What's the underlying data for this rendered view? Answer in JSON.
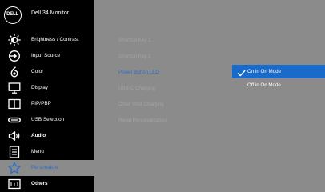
{
  "header": {
    "logo_text": "DELL",
    "model": "Dell 34 Monitor"
  },
  "menu": {
    "items": [
      {
        "label": "Brightness / Contrast",
        "icon": "brightness-icon"
      },
      {
        "label": "Input Source",
        "icon": "input-source-icon"
      },
      {
        "label": "Color",
        "icon": "color-icon"
      },
      {
        "label": "Display",
        "icon": "display-icon"
      },
      {
        "label": "PIP/PBP",
        "icon": "pip-pbp-icon"
      },
      {
        "label": "USB Selection",
        "icon": "usb-icon"
      },
      {
        "label": "Audio",
        "icon": "speaker-icon"
      },
      {
        "label": "Menu",
        "icon": "menu-document-icon"
      },
      {
        "label": "Personalize",
        "icon": "star-icon",
        "selected": true
      },
      {
        "label": "Others",
        "icon": "others-icon"
      }
    ]
  },
  "submenu": {
    "items": [
      {
        "label": "Shortcut Key 1"
      },
      {
        "label": "Shortcut Key 2"
      },
      {
        "label": "Power Button LED",
        "active": true
      },
      {
        "label": "USB-C Charging"
      },
      {
        "label": "Other USB Charging"
      },
      {
        "label": "Reset Personalization"
      }
    ]
  },
  "options": {
    "items": [
      {
        "label": "On in On Mode",
        "selected": true
      },
      {
        "label": "Off in On Mode",
        "selected": false
      }
    ]
  },
  "colors": {
    "menu_background": "#000000",
    "panel_background": "#8b8b8b",
    "accent": "#1a6ac9",
    "active_text": "#2c6fc8",
    "dim_text": "#a3a3a3"
  }
}
